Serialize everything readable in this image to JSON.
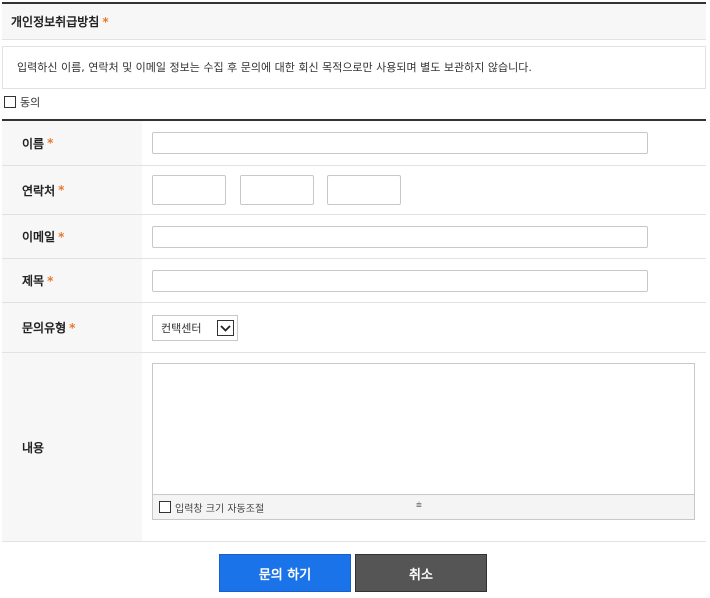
{
  "privacy": {
    "title": "개인정보취급방침",
    "required_mark": "*",
    "notice": "입력하신 이름, 연락처 및 이메일 정보는 수집 후 문의에 대한 회신 목적으로만 사용되며 별도 보관하지 않습니다.",
    "agree_label": "동의",
    "agree_checked": false
  },
  "form": {
    "name_label": "이름",
    "phone_label": "연락처",
    "email_label": "이메일",
    "subject_label": "제목",
    "type_label": "문의유형",
    "content_label": "내용",
    "required_mark": "*",
    "type_selected": "컨택센터",
    "autosize_label": "입력창 크기 자동조절",
    "resize_glyph": "⩧"
  },
  "buttons": {
    "submit": "문의 하기",
    "cancel": "취소"
  },
  "colors": {
    "accent": "#1a73e8",
    "cancel": "#555555",
    "required": "#e8792b"
  }
}
